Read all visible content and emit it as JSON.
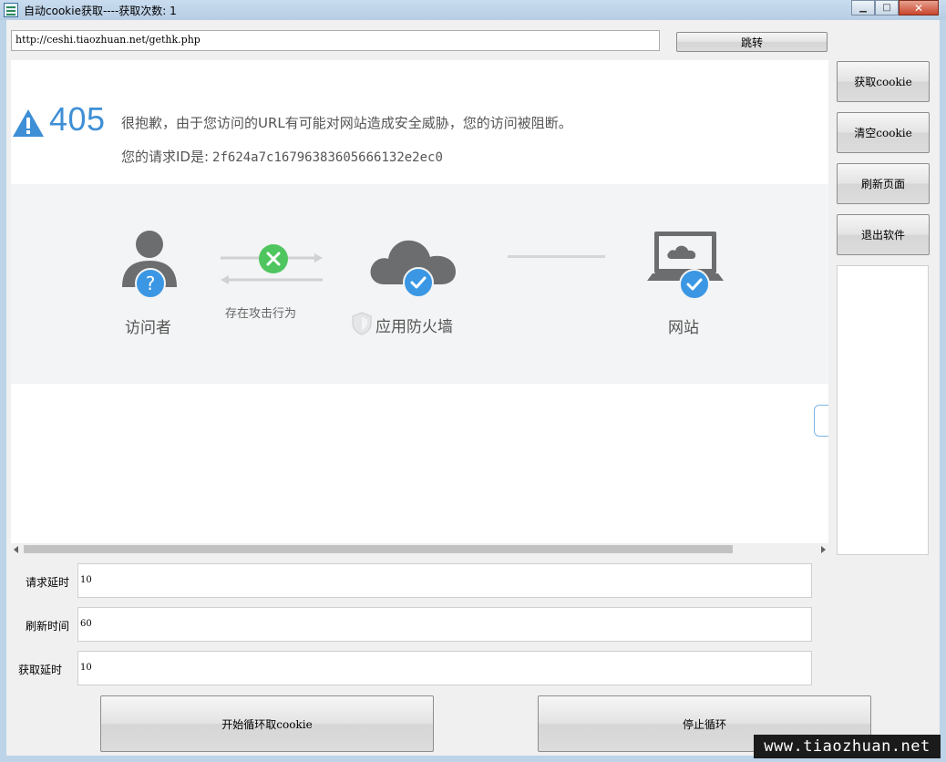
{
  "window": {
    "title": "自动cookie获取----获取次数: 1",
    "controls": {
      "minimize": "▁",
      "maximize": "□",
      "close": "✕"
    }
  },
  "toolbar": {
    "url_value": "http://ceshi.tiaozhuan.net/gethk.php",
    "go_button": "跳转"
  },
  "side_buttons": {
    "get_cookie": "获取cookie",
    "clear_cookie": "清空cookie",
    "refresh_page": "刷新页面",
    "exit_app": "退出软件"
  },
  "browser": {
    "error_code": "405",
    "message": "很抱歉，由于您访问的URL有可能对网站造成安全威胁，您的访问被阻断。",
    "request_id_label": "您的请求ID是:",
    "request_id": "2f624a7c16796383605666132e2ec0",
    "diagram": {
      "visitor": "访问者",
      "attack": "存在攻击行为",
      "firewall": "应用防火墙",
      "website": "网站"
    }
  },
  "settings": {
    "request_delay_label": "请求延时",
    "request_delay_value": "10",
    "refresh_time_label": "刷新时间",
    "refresh_time_value": "60",
    "fetch_delay_label": "获取延时",
    "fetch_delay_value": "10"
  },
  "actions": {
    "start_loop": "开始循环取cookie",
    "stop_loop": "停止循环"
  },
  "watermark": "www.tiaozhuan.net",
  "colors": {
    "brand_blue": "#3e8fd6",
    "icon_gray": "#6c6d6f",
    "success_green": "#4fc55f",
    "badge_blue": "#3b97e3"
  }
}
